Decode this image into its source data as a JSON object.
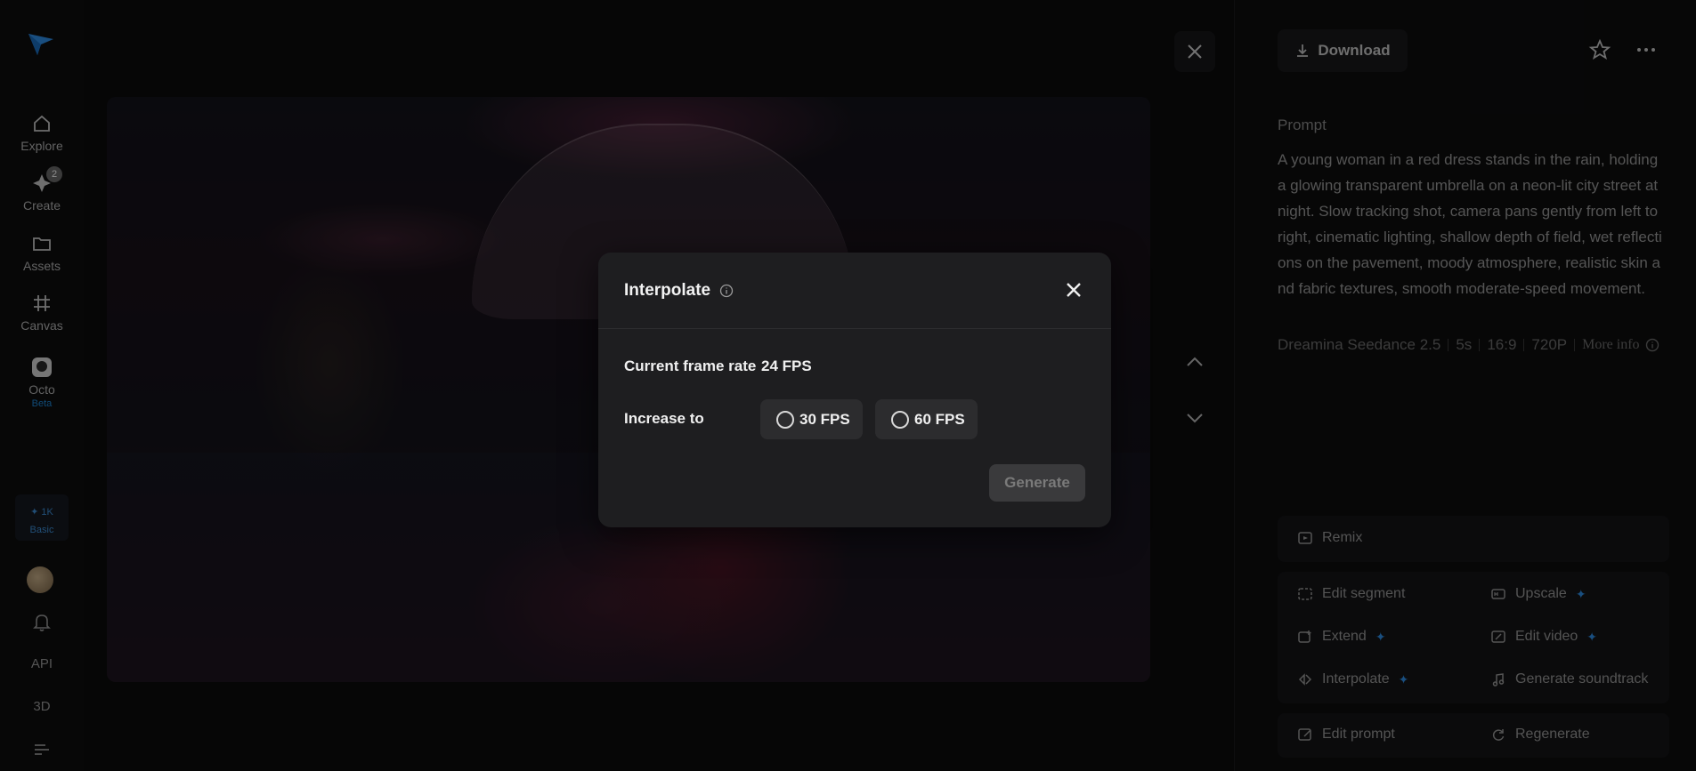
{
  "sidebar": {
    "nav": [
      {
        "label": "Explore",
        "icon": "home-icon"
      },
      {
        "label": "Create",
        "icon": "create-icon",
        "badge": "2"
      },
      {
        "label": "Assets",
        "icon": "folder-icon"
      },
      {
        "label": "Canvas",
        "icon": "canvas-icon"
      },
      {
        "label": "Octo",
        "icon": "octo-icon",
        "tag": "Beta"
      }
    ],
    "credits": {
      "amount": "✦ 1K",
      "plan": "Basic"
    },
    "api_label": "API",
    "three_d_label": "3D"
  },
  "header": {
    "download_label": "Download"
  },
  "prompt": {
    "label": "Prompt",
    "text": "A young woman in a red dress stands in the rain, holding a glowing transparent umbrella on a neon-lit city street at night. Slow tracking shot, camera pans gently from left to right, cinematic lighting, shallow depth of field, wet reflections on the pavement, moody atmosphere, realistic skin and fabric textures, smooth moderate-speed movement."
  },
  "meta": {
    "model": "Dreamina Seedance 2.5",
    "duration": "5s",
    "ratio": "16:9",
    "resolution": "720P",
    "more_info": "More info"
  },
  "actions": {
    "remix": "Remix",
    "edit_segment": "Edit segment",
    "upscale": "Upscale",
    "extend": "Extend",
    "edit_video": "Edit video",
    "interpolate": "Interpolate",
    "generate_soundtrack": "Generate soundtrack",
    "edit_prompt": "Edit prompt",
    "regenerate": "Regenerate"
  },
  "modal": {
    "title": "Interpolate",
    "current_label": "Current frame rate",
    "current_value": "24 FPS",
    "increase_label": "Increase to",
    "options": [
      "30 FPS",
      "60 FPS"
    ],
    "generate_label": "Generate"
  },
  "colors": {
    "accent": "#2f8fe8",
    "background": "#0b0b0c",
    "modal": "#1e1e20"
  }
}
